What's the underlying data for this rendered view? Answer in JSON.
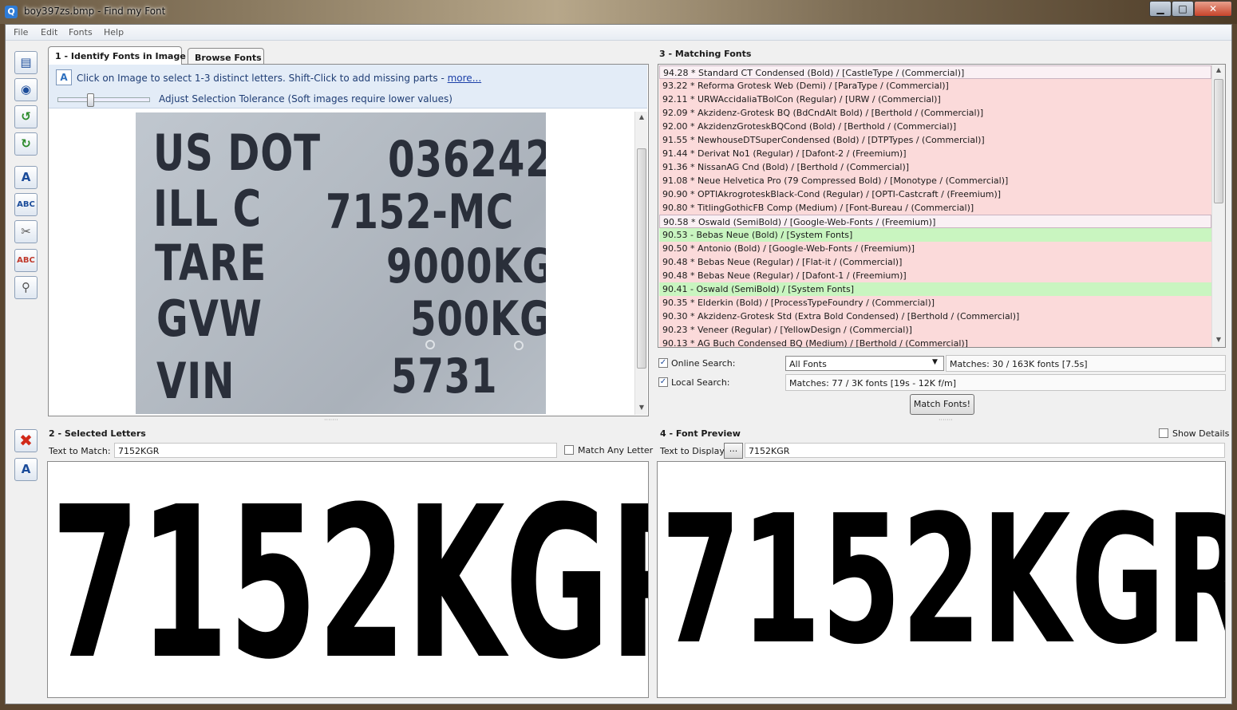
{
  "window": {
    "title": "boy397zs.bmp - Find my Font",
    "app_icon": "magnifier-icon",
    "min": "▁",
    "max": "□",
    "close": "✕"
  },
  "menu": [
    "File",
    "Edit",
    "Fonts",
    "Help"
  ],
  "toolbar_icons": [
    "open-image-icon",
    "camera-icon",
    "rotate-left-icon",
    "rotate-right-icon",
    "add-letter-icon",
    "auto-select-icon",
    "scissors-icon",
    "letters-icon",
    "zoom-icon"
  ],
  "tabs": {
    "identify": "1 - Identify Fonts in Image",
    "browse": "Browse Fonts"
  },
  "hint": {
    "text": "Click on Image to select 1-3 distinct letters. Shift-Click to add missing parts - ",
    "more": "more...",
    "tolerance": "Adjust Selection Tolerance (Soft images require lower values)",
    "tolerance_level": 0.35
  },
  "plate_lines": [
    {
      "left": "US DOT",
      "right": "036242"
    },
    {
      "left": "ILL C",
      "right": "7152-MC"
    },
    {
      "left": "TARE",
      "right": "9000KG"
    },
    {
      "left": "GVW",
      "right": "500KG"
    },
    {
      "left": "VIN",
      "right": "5731"
    }
  ],
  "matching": {
    "title": "3 - Matching Fonts",
    "rows": [
      {
        "text": "94.28 * Standard CT Condensed (Bold) / [CastleType / (Commercial)]",
        "status": "sel"
      },
      {
        "text": "93.22 * Reforma Grotesk Web (Demi) / [ParaType / (Commercial)]",
        "status": "bad"
      },
      {
        "text": "92.11 * URWAccidaliaTBolCon (Regular) / [URW / (Commercial)]",
        "status": "bad"
      },
      {
        "text": "92.09 * Akzidenz-Grotesk BQ (BdCndAlt Bold) / [Berthold / (Commercial)]",
        "status": "bad"
      },
      {
        "text": "92.00 * AkzidenzGroteskBQCond (Bold) / [Berthold / (Commercial)]",
        "status": "bad"
      },
      {
        "text": "91.55 * NewhouseDTSuperCondensed (Bold) / [DTPTypes / (Commercial)]",
        "status": "bad"
      },
      {
        "text": "91.44 * Derivat No1 (Regular) / [Dafont-2 / (Freemium)]",
        "status": "bad"
      },
      {
        "text": "91.36 * NissanAG Cnd (Bold) / [Berthold / (Commercial)]",
        "status": "bad"
      },
      {
        "text": "91.08 * Neue Helvetica Pro (79 Compressed Bold) / [Monotype / (Commercial)]",
        "status": "bad"
      },
      {
        "text": "90.90 * OPTIAkrogroteskBlack-Cond (Regular) / [OPTI-Castcraft / (Freemium)]",
        "status": "bad"
      },
      {
        "text": "90.80 * TitlingGothicFB Comp (Medium) / [Font-Bureau / (Commercial)]",
        "status": "bad"
      },
      {
        "text": "90.58 * Oswald (SemiBold) / [Google-Web-Fonts / (Freemium)]",
        "status": "sel"
      },
      {
        "text": "90.53 - Bebas Neue (Bold) / [System Fonts]",
        "status": "good"
      },
      {
        "text": "90.50 * Antonio (Bold) / [Google-Web-Fonts / (Freemium)]",
        "status": "bad"
      },
      {
        "text": "90.48 * Bebas Neue (Regular) / [Flat-it / (Commercial)]",
        "status": "bad"
      },
      {
        "text": "90.48 * Bebas Neue (Regular) / [Dafont-1 / (Freemium)]",
        "status": "bad"
      },
      {
        "text": "90.41 - Oswald (SemiBold) / [System Fonts]",
        "status": "good"
      },
      {
        "text": "90.35 * Elderkin (Bold) / [ProcessTypeFoundry / (Commercial)]",
        "status": "bad"
      },
      {
        "text": "90.30 * Akzidenz-Grotesk Std (Extra Bold Condensed) / [Berthold / (Commercial)]",
        "status": "bad"
      },
      {
        "text": "90.23 * Veneer (Regular) / [YellowDesign / (Commercial)]",
        "status": "bad"
      },
      {
        "text": "90.13 * AG Buch Condensed BQ (Medium) / [Berthold / (Commercial)]",
        "status": "bad"
      }
    ],
    "online_label": "Online Search:",
    "font_filter": "All Fonts",
    "online_matches": "Matches: 30 / 163K fonts [7.5s]",
    "local_label": "Local Search:",
    "local_matches": "Matches: 77 / 3K fonts [19s - 12K f/m]",
    "match_button": "Match Fonts!"
  },
  "selected": {
    "title": "2 - Selected Letters",
    "text_label": "Text to Match:",
    "text_value": "7152KGR",
    "any_letter": "Match Any Letter"
  },
  "preview": {
    "title": "4 - Font Preview",
    "show_details": "Show Details",
    "text_label": "Text to Display:",
    "browse_button": "...",
    "text_value": "7152KGR"
  }
}
